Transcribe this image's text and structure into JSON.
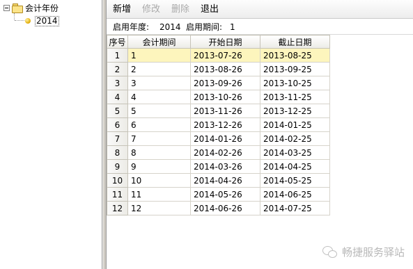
{
  "tree": {
    "root_label": "会计年份",
    "children": [
      "2014"
    ]
  },
  "toolbar": {
    "add_label": "新增",
    "edit_label": "修改",
    "delete_label": "删除",
    "exit_label": "退出"
  },
  "info": {
    "year_label": "启用年度:",
    "year_value": "2014",
    "period_label": "启用期间:",
    "period_value": "1"
  },
  "grid": {
    "columns": [
      "序号",
      "会计期间",
      "开始日期",
      "截止日期"
    ],
    "rows": [
      [
        "1",
        "1",
        "2013-07-26",
        "2013-08-25"
      ],
      [
        "2",
        "2",
        "2013-08-26",
        "2013-09-25"
      ],
      [
        "3",
        "3",
        "2013-09-26",
        "2013-10-25"
      ],
      [
        "4",
        "4",
        "2013-10-26",
        "2013-11-25"
      ],
      [
        "5",
        "5",
        "2013-11-26",
        "2013-12-25"
      ],
      [
        "6",
        "6",
        "2013-12-26",
        "2014-01-25"
      ],
      [
        "7",
        "7",
        "2014-01-26",
        "2014-02-25"
      ],
      [
        "8",
        "8",
        "2014-02-26",
        "2014-03-25"
      ],
      [
        "9",
        "9",
        "2014-03-26",
        "2014-04-25"
      ],
      [
        "10",
        "10",
        "2014-04-26",
        "2014-05-25"
      ],
      [
        "11",
        "11",
        "2014-05-26",
        "2014-06-25"
      ],
      [
        "12",
        "12",
        "2014-06-26",
        "2014-07-25"
      ]
    ],
    "selected_row": 0
  },
  "watermark": {
    "text": "畅捷服务驿站",
    "icon": "wechat-icon"
  },
  "colors": {
    "selected_row": "#fdf5bd",
    "disabled_text": "#a9a9a9",
    "header_border": "#c6c3b8"
  }
}
